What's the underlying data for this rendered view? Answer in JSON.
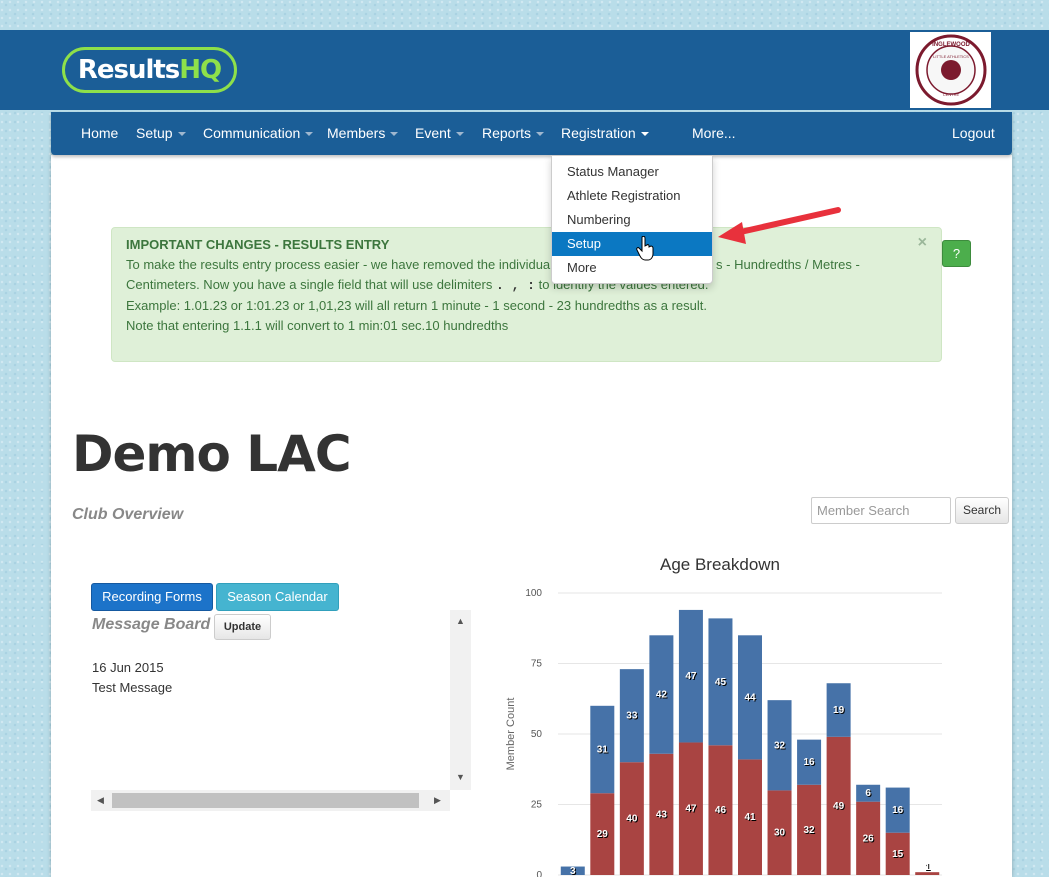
{
  "brand": {
    "logo_main": "Results",
    "logo_accent": "HQ",
    "badge_top": "INGLEWOOD",
    "badge_ring": "LITTLE ATHLETICS",
    "badge_bottom": "CENTRE"
  },
  "nav": {
    "items": [
      {
        "label": "Home",
        "caret": false
      },
      {
        "label": "Setup",
        "caret": true
      },
      {
        "label": "Communication",
        "caret": true
      },
      {
        "label": "Members",
        "caret": true
      },
      {
        "label": "Event",
        "caret": true
      },
      {
        "label": "Reports",
        "caret": true
      },
      {
        "label": "Registration",
        "caret": true
      },
      {
        "label": "More...",
        "caret": false
      }
    ],
    "logout": "Logout"
  },
  "registration_menu": {
    "items": [
      "Status Manager",
      "Athlete Registration",
      "Numbering",
      "Setup",
      "More"
    ],
    "active": "Setup"
  },
  "alert": {
    "title": "IMPORTANT CHANGES - RESULTS ENTRY",
    "lines": [
      "To make the results entry process easier - we have removed the individual",
      "s - Hundredths / Metres -",
      "Centimeters. Now you have a single field that will use delimiters",
      ". , :",
      "to identify the values entered.",
      "Example: 1.01.23 or 1:01.23 or 1,01,23 will all return 1 minute - 1 second - 23 hundredths as a result.",
      "Note that entering 1.1.1 will convert to 1 min:01 sec.10 hundredths"
    ],
    "close": "×",
    "help": "?"
  },
  "club": {
    "name": "Demo LAC",
    "overview": "Club Overview"
  },
  "search": {
    "placeholder": "Member Search",
    "button": "Search"
  },
  "buttons": {
    "recording_forms": "Recording Forms",
    "season_calendar": "Season Calendar",
    "update": "Update"
  },
  "message_board": {
    "title": "Message Board",
    "date": "16 Jun 2015",
    "text": "Test Message"
  },
  "colors": {
    "navy": "#1b5e97",
    "series_top": "#4672a8",
    "series_bottom": "#a94442",
    "alert_bg": "#dff0d8",
    "alert_text": "#3c763d"
  },
  "chart_data": {
    "type": "bar",
    "stacked": true,
    "title": "Age Breakdown",
    "ylabel": "Member Count",
    "ylim": [
      0,
      100
    ],
    "yticks": [
      0,
      25,
      50,
      75,
      100
    ],
    "grid": true,
    "series": [
      {
        "values": [
          0,
          29,
          40,
          43,
          47,
          46,
          41,
          30,
          32,
          49,
          26,
          15,
          1
        ],
        "color": "#a94442"
      },
      {
        "values": [
          3,
          31,
          33,
          42,
          47,
          45,
          44,
          32,
          16,
          19,
          6,
          16,
          0
        ],
        "color": "#4672a8"
      }
    ]
  }
}
